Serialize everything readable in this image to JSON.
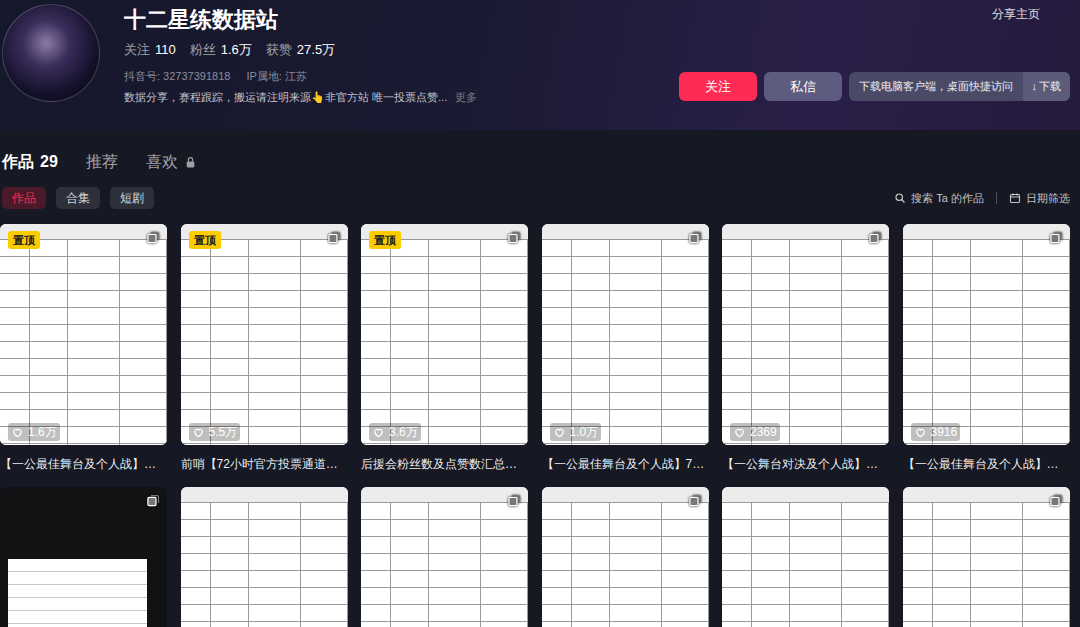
{
  "profile": {
    "name": "十二星练数据站",
    "stats": [
      {
        "label": "关注",
        "value": "110"
      },
      {
        "label": "粉丝",
        "value": "1.6万"
      },
      {
        "label": "获赞",
        "value": "27.5万"
      }
    ],
    "douyin_id": "抖音号: 32737391818",
    "ip": "IP属地: 江苏",
    "bio": "数据分享，赛程跟踪，搬运请注明来源👆非官方站 唯一投票点赞...",
    "more": "更多"
  },
  "share": "分享主页",
  "buttons": {
    "follow": "关注",
    "message": "私信",
    "download_prompt": "下载电脑客户端，桌面快捷访问",
    "download_icon": "↓",
    "download": "下载"
  },
  "tabs": [
    {
      "label": "作品",
      "count": "29",
      "selected": true,
      "locked": false
    },
    {
      "label": "推荐",
      "count": "",
      "selected": false,
      "locked": false
    },
    {
      "label": "喜欢",
      "count": "",
      "selected": false,
      "locked": true
    }
  ],
  "subtabs": [
    {
      "label": "作品",
      "selected": true
    },
    {
      "label": "合集",
      "selected": false
    },
    {
      "label": "短剧",
      "selected": false
    }
  ],
  "search": {
    "label": "搜索 Ta 的作品"
  },
  "date_filter": {
    "label": "日期筛选"
  },
  "videos": [
    {
      "kind": "light",
      "pinned": true,
      "pin_label": "置顶",
      "multi_image": true,
      "likes": "1.6万",
      "title": "【一公最佳舞台及个人战】…"
    },
    {
      "kind": "light",
      "pinned": true,
      "pin_label": "置顶",
      "multi_image": true,
      "likes": "5.5万",
      "title": "前哨【72小时官方投票通道…"
    },
    {
      "kind": "light",
      "pinned": true,
      "pin_label": "置顶",
      "multi_image": true,
      "likes": "3.6万",
      "title": "后援会粉丝数及点赞数汇总…"
    },
    {
      "kind": "light",
      "pinned": false,
      "pin_label": "",
      "multi_image": true,
      "likes": "1.0万",
      "title": "【一公最佳舞台及个人战】7…"
    },
    {
      "kind": "light",
      "pinned": false,
      "pin_label": "",
      "multi_image": true,
      "likes": "2369",
      "title": "【一公舞台对决及个人战】…"
    },
    {
      "kind": "light",
      "pinned": false,
      "pin_label": "",
      "multi_image": true,
      "likes": "3916",
      "title": "【一公最佳舞台及个人战】…"
    },
    {
      "kind": "dark",
      "pinned": false,
      "pin_label": "",
      "multi_image": true
    },
    {
      "kind": "light",
      "pinned": false,
      "pin_label": "",
      "multi_image": false
    },
    {
      "kind": "light",
      "pinned": false,
      "pin_label": "",
      "multi_image": true
    },
    {
      "kind": "light",
      "pinned": false,
      "pin_label": "",
      "multi_image": true
    },
    {
      "kind": "light",
      "pinned": false,
      "pin_label": "",
      "multi_image": false
    },
    {
      "kind": "light",
      "pinned": false,
      "pin_label": "",
      "multi_image": true
    }
  ]
}
